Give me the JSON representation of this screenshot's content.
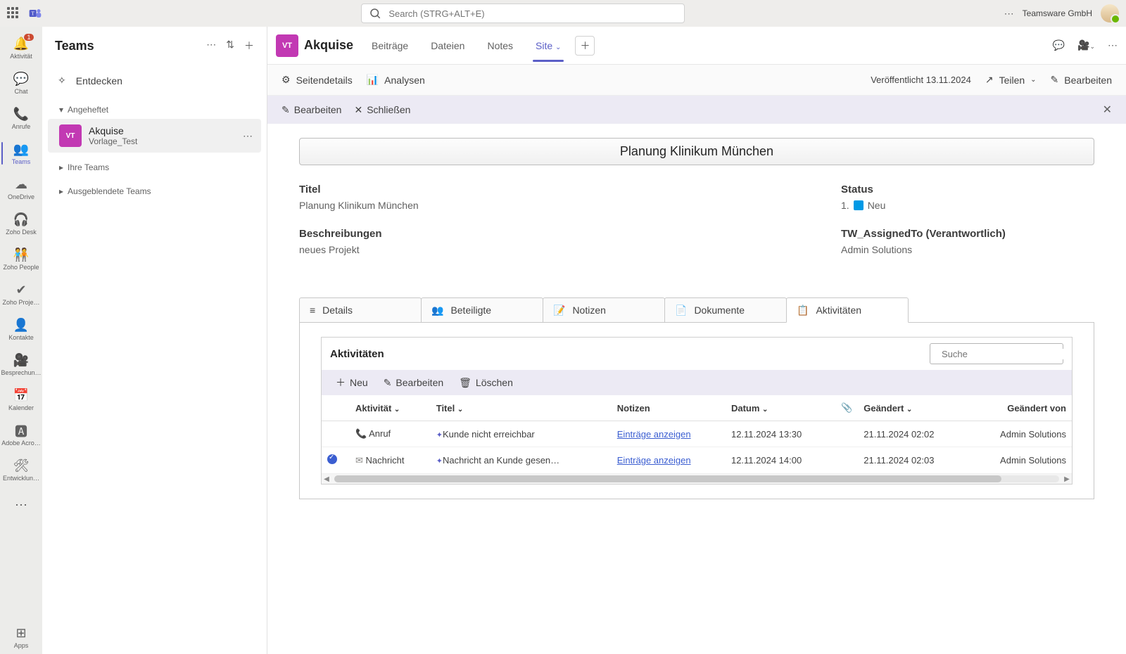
{
  "top": {
    "search_placeholder": "Search (STRG+ALT+E)",
    "org": "Teamsware GmbH"
  },
  "rail": {
    "activity": "Aktivität",
    "activity_badge": "1",
    "chat": "Chat",
    "calls": "Anrufe",
    "teams": "Teams",
    "onedrive": "OneDrive",
    "zoho_desk": "Zoho Desk",
    "zoho_people": "Zoho People",
    "zoho_proj": "Zoho Proje…",
    "contacts": "Kontakte",
    "meetings": "Besprechun…",
    "calendar": "Kalender",
    "adobe": "Adobe Acro…",
    "dev": "Entwicklun…",
    "apps": "Apps"
  },
  "teamscol": {
    "title": "Teams",
    "discover": "Entdecken",
    "pinned": "Angeheftet",
    "channel_name": "Akquise",
    "channel_sub": "Vorlage_Test",
    "channel_code": "VT",
    "your_teams": "Ihre Teams",
    "hidden": "Ausgeblendete Teams"
  },
  "tabs": {
    "chip": "VT",
    "name": "Akquise",
    "items": [
      "Beiträge",
      "Dateien",
      "Notes",
      "Site"
    ],
    "active_index": 3
  },
  "cmd": {
    "details": "Seitendetails",
    "analysen": "Analysen",
    "published": "Veröffentlicht 13.11.2024",
    "share": "Teilen",
    "edit": "Bearbeiten"
  },
  "strip": {
    "edit": "Bearbeiten",
    "close": "Schließen"
  },
  "page": {
    "title": "Planung Klinikum München",
    "f_title_lbl": "Titel",
    "f_title_val": "Planung Klinikum München",
    "f_desc_lbl": "Beschreibungen",
    "f_desc_val": "neues Projekt",
    "f_status_lbl": "Status",
    "f_status_num": "1.",
    "f_status_val": "Neu",
    "f_assigned_lbl": "TW_AssignedTo (Verantwortlich)",
    "f_assigned_val": "Admin Solutions"
  },
  "ltabs": [
    "Details",
    "Beteiligte",
    "Notizen",
    "Dokumente",
    "Aktivitäten"
  ],
  "act": {
    "heading": "Aktivitäten",
    "search_ph": "Suche",
    "new": "Neu",
    "edit": "Bearbeiten",
    "delete": "Löschen",
    "cols": {
      "activity": "Aktivität",
      "title": "Titel",
      "notes": "Notizen",
      "date": "Datum",
      "modified": "Geändert",
      "modifiedby": "Geändert von"
    },
    "rows": [
      {
        "selected": false,
        "kind": "Anruf",
        "kind_icon": "phone",
        "title": "Kunde nicht erreichbar",
        "notes": "Einträge anzeigen",
        "date": "12.11.2024 13:30",
        "modified": "21.11.2024 02:02",
        "by": "Admin Solutions"
      },
      {
        "selected": true,
        "kind": "Nachricht",
        "kind_icon": "mail",
        "title": "Nachricht an Kunde gesen…",
        "notes": "Einträge anzeigen",
        "date": "12.11.2024 14:00",
        "modified": "21.11.2024 02:03",
        "by": "Admin Solutions"
      }
    ]
  }
}
